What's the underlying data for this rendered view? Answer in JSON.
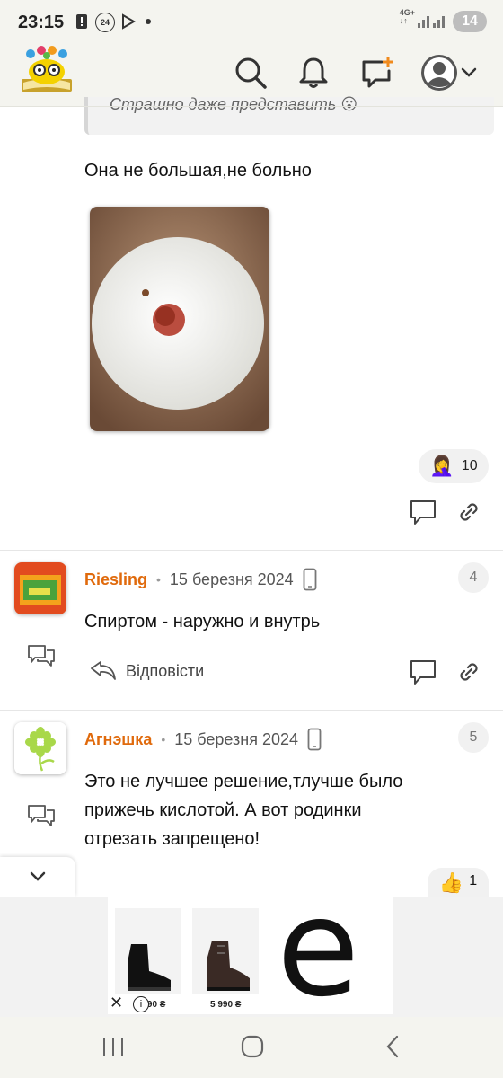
{
  "status_bar": {
    "time": "23:15",
    "notification_count": "24",
    "network": "4G+",
    "battery": "14"
  },
  "header": {
    "icons": [
      "logo-icon",
      "search-icon",
      "bell-icon",
      "new-post-icon",
      "avatar-icon",
      "chevron-down-icon"
    ]
  },
  "quote": {
    "text": "Страшно даже представить 😮"
  },
  "post": {
    "text": "Она не большая,не больно",
    "reaction_emoji": "🤦‍♀️",
    "reaction_count": "10"
  },
  "comments": [
    {
      "author": "Riesling",
      "date": "15 березня 2024",
      "number": "4",
      "text": "Спиртом - наружно и внутрь",
      "reply_label": "Відповісти"
    },
    {
      "author": "Агнэшка",
      "date": "15 березня 2024",
      "number": "5",
      "text_line1": "Это не лучшее решение,тлучше было",
      "text_line2": "прижечь кислотой. А вот родинки",
      "text_line3": "отрезать запрещено!",
      "reaction_emoji": "👍",
      "reaction_count": "1"
    }
  ],
  "ad": {
    "price1": "5 990 ₴",
    "price2": "5 990 ₴",
    "brand_logo": "e"
  },
  "colors": {
    "author": "#e06a0c",
    "header_bg": "#f4f4ef"
  }
}
